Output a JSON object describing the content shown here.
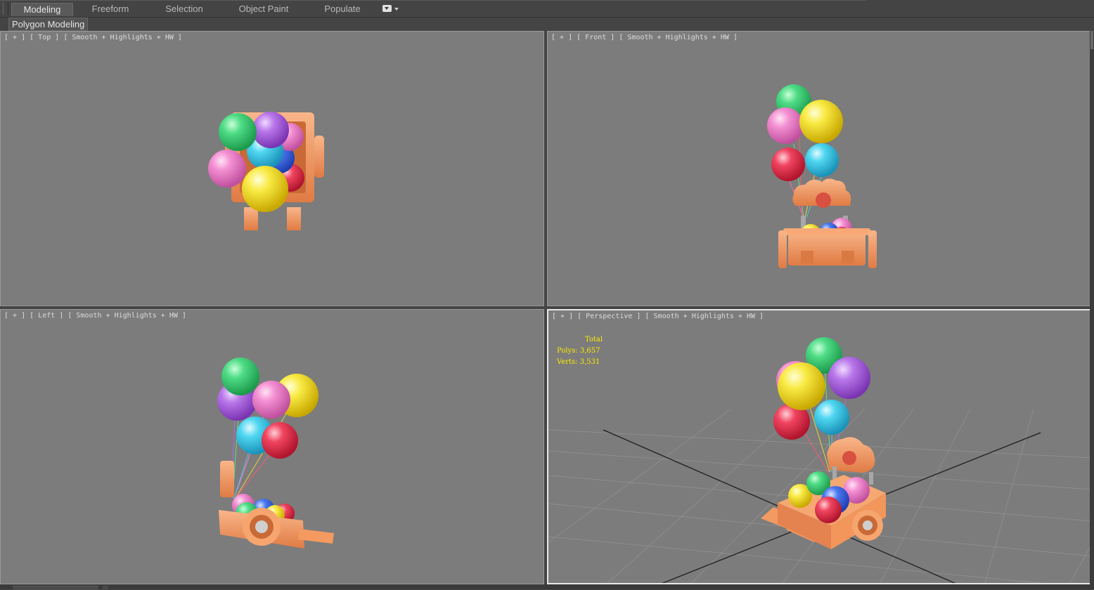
{
  "tabs": [
    {
      "label": "Modeling",
      "active": true
    },
    {
      "label": "Freeform",
      "active": false
    },
    {
      "label": "Selection",
      "active": false
    },
    {
      "label": "Object Paint",
      "active": false
    },
    {
      "label": "Populate",
      "active": false
    }
  ],
  "ribbon": {
    "label": "Polygon Modeling"
  },
  "viewports": {
    "top": {
      "plus": "[ + ]",
      "view": "[ Top ]",
      "shading": "[ Smooth + Highlights + HW ]"
    },
    "front": {
      "plus": "[ + ]",
      "view": "[ Front ]",
      "shading": "[ Smooth + Highlights + HW ]"
    },
    "left": {
      "plus": "[ + ]",
      "view": "[ Left ]",
      "shading": "[ Smooth + Highlights + HW ]"
    },
    "perspective": {
      "plus": "[ + ]",
      "view": "[ Perspective ]",
      "shading": "[ Smooth + Highlights + HW ]"
    }
  },
  "stats": {
    "total": "Total",
    "polys": "Polys: 3,657",
    "verts": "Verts: 3,531"
  },
  "colors": {
    "viewport_bg": "#7c7c7c",
    "stats_text": "#ffea00",
    "wood": "#f0935a",
    "balloon_green": "#3fd77a",
    "balloon_yellow": "#f7e33c",
    "balloon_pink": "#f28ad0",
    "balloon_purple": "#b06be3",
    "balloon_cyan": "#3fd0ee",
    "balloon_red": "#ee3b55",
    "balloon_blue": "#3f6df0"
  }
}
